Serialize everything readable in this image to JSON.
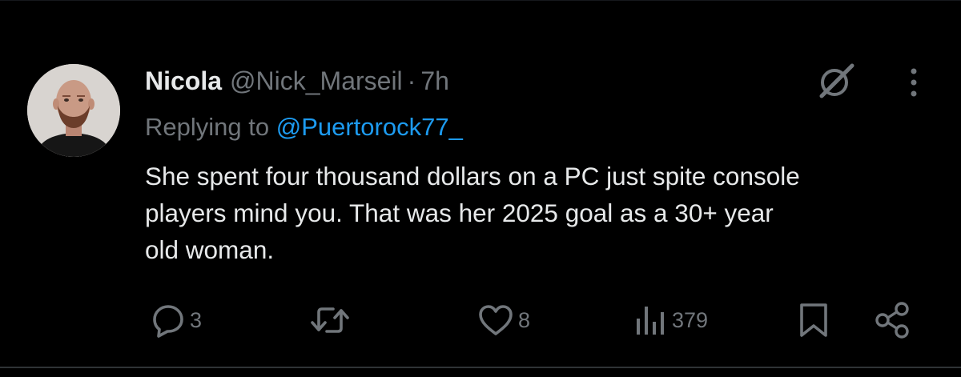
{
  "tweet": {
    "author_name": "Nicola",
    "author_handle": "@Nick_Marseil",
    "separator": "·",
    "time": "7h",
    "replying_label": "Replying to",
    "replying_to": "@Puertorock77_",
    "text": "She spent four thousand dollars on a PC just spite console\nplayers mind you. That was her 2025 goal as a 30+ year\nold woman."
  },
  "actions": {
    "replies": "3",
    "likes": "8",
    "views": "379"
  },
  "icons": {
    "header": [
      "grok-icon",
      "more-icon"
    ],
    "actions": [
      "reply-icon",
      "retweet-icon",
      "like-icon",
      "views-icon",
      "bookmark-icon",
      "share-icon"
    ]
  },
  "colors": {
    "background": "#000000",
    "text": "#e7e9ea",
    "secondary": "#71767b",
    "link": "#1d9bf0"
  }
}
